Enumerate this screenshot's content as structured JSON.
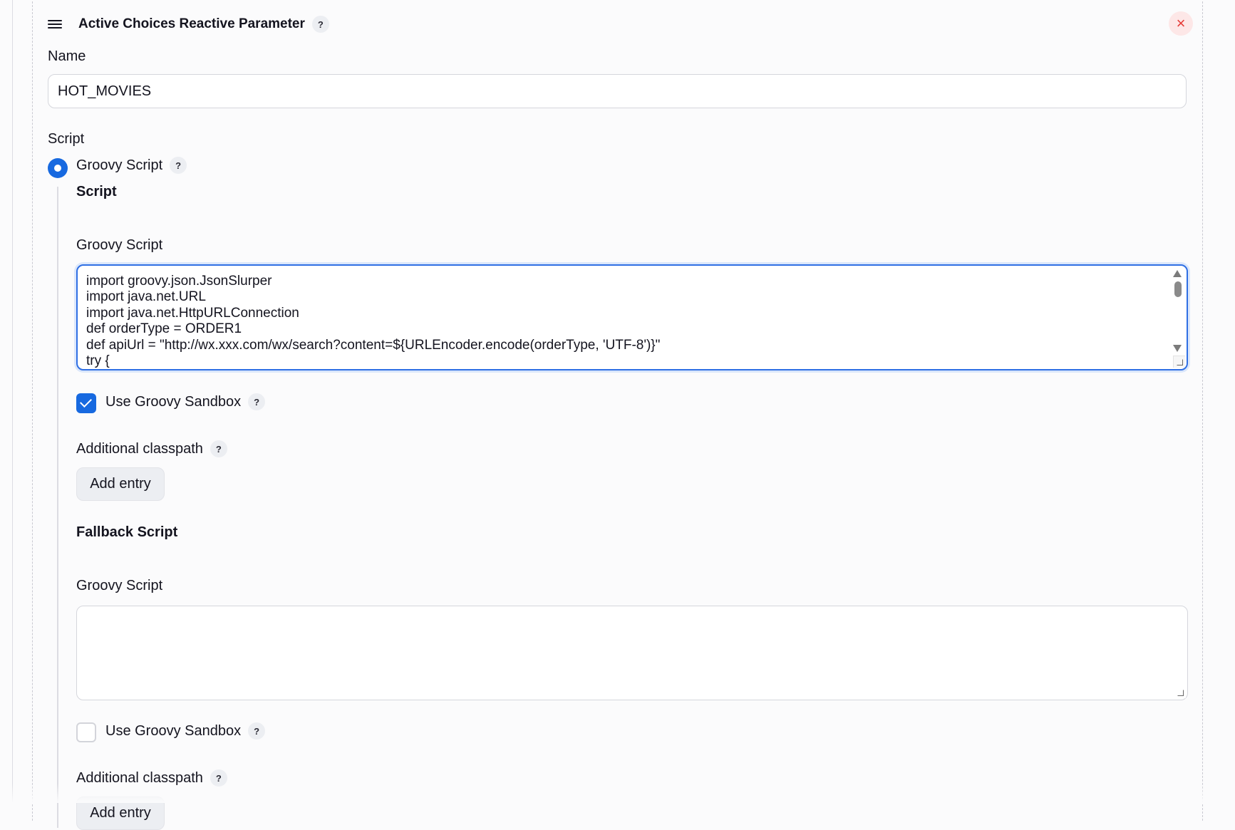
{
  "header": {
    "title": "Active Choices Reactive Parameter",
    "help": "?",
    "close": "×"
  },
  "name_field": {
    "label": "Name",
    "value": "HOT_MOVIES"
  },
  "script_section": {
    "label": "Script",
    "radio_label": "Groovy Script",
    "help": "?",
    "script_heading": "Script",
    "groovy_label": "Groovy Script",
    "code_lines": [
      "import groovy.json.JsonSlurper",
      "import java.net.URL",
      "import java.net.HttpURLConnection",
      "def orderType = ORDER1",
      "def apiUrl = \"http://wx.xxx.com/wx/search?content=${URLEncoder.encode(orderType, 'UTF-8')}\"",
      "try {"
    ],
    "sandbox_label": "Use Groovy Sandbox",
    "sandbox_checked": true,
    "classpath_label": "Additional classpath",
    "add_entry": "Add entry"
  },
  "fallback_section": {
    "heading": "Fallback Script",
    "groovy_label": "Groovy Script",
    "code_value": "",
    "sandbox_label": "Use Groovy Sandbox",
    "sandbox_checked": false,
    "classpath_label": "Additional classpath",
    "add_entry": "Add entry"
  },
  "colors": {
    "accent": "#1769e0",
    "close": "#e53935"
  }
}
